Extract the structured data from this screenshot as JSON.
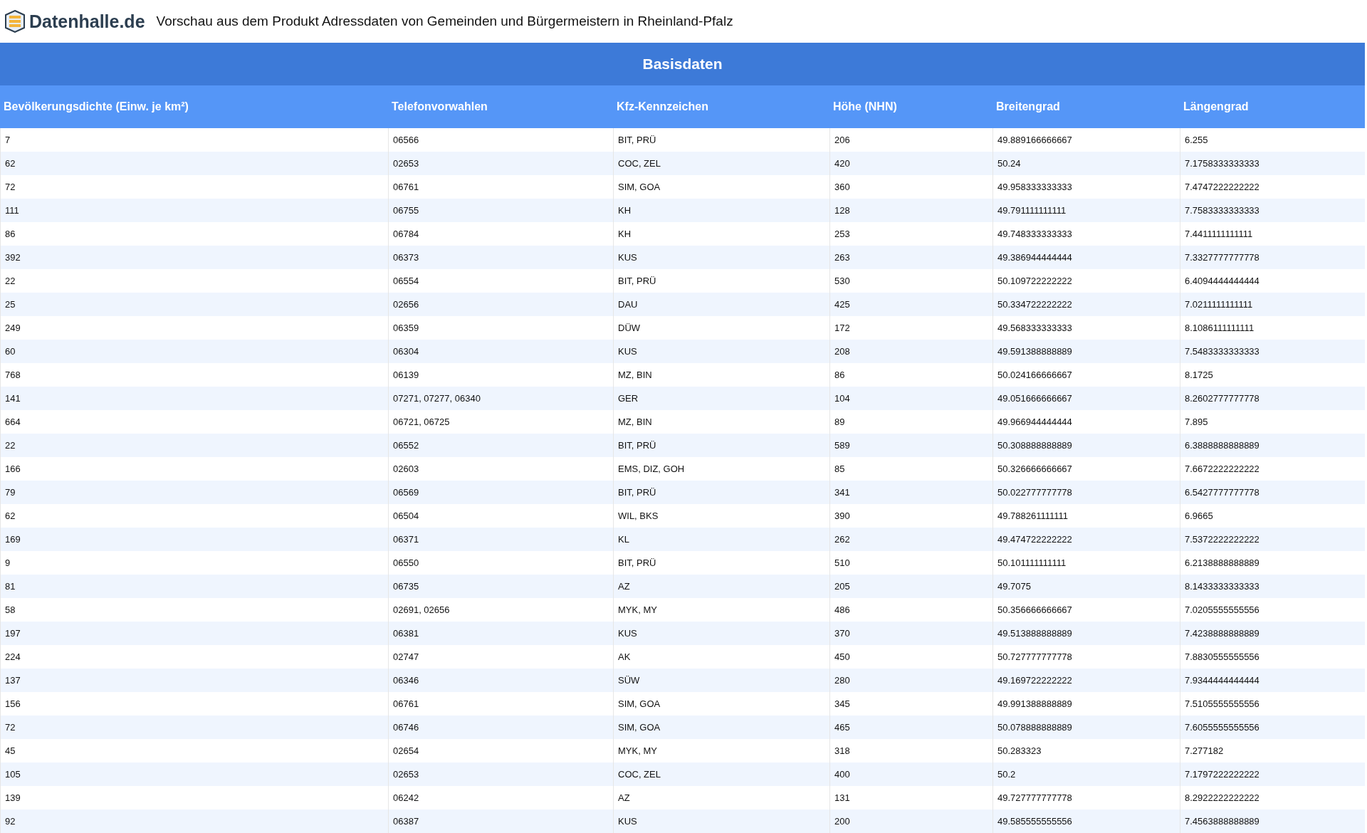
{
  "header": {
    "logo": "Datenhalle.de",
    "title": "Vorschau aus dem Produkt Adressdaten von Gemeinden und Bürgermeistern in Rheinland-Pfalz"
  },
  "table": {
    "group_title": "Basisdaten",
    "columns": [
      "Bevölkerungsdichte (Einw. je km²)",
      "Telefonvorwahlen",
      "Kfz-Kennzeichen",
      "Höhe (NHN)",
      "Breitengrad",
      "Längengrad"
    ],
    "rows": [
      [
        "7",
        "06566",
        "BIT, PRÜ",
        "206",
        "49.889166666667",
        "6.255"
      ],
      [
        "62",
        "02653",
        "COC, ZEL",
        "420",
        "50.24",
        "7.1758333333333"
      ],
      [
        "72",
        "06761",
        "SIM, GOA",
        "360",
        "49.958333333333",
        "7.4747222222222"
      ],
      [
        "111",
        "06755",
        "KH",
        "128",
        "49.791111111111",
        "7.7583333333333"
      ],
      [
        "86",
        "06784",
        "KH",
        "253",
        "49.748333333333",
        "7.4411111111111"
      ],
      [
        "392",
        "06373",
        "KUS",
        "263",
        "49.386944444444",
        "7.3327777777778"
      ],
      [
        "22",
        "06554",
        "BIT, PRÜ",
        "530",
        "50.109722222222",
        "6.4094444444444"
      ],
      [
        "25",
        "02656",
        "DAU",
        "425",
        "50.334722222222",
        "7.0211111111111"
      ],
      [
        "249",
        "06359",
        "DÜW",
        "172",
        "49.568333333333",
        "8.1086111111111"
      ],
      [
        "60",
        "06304",
        "KUS",
        "208",
        "49.591388888889",
        "7.5483333333333"
      ],
      [
        "768",
        "06139",
        "MZ, BIN",
        "86",
        "50.024166666667",
        "8.1725"
      ],
      [
        "141",
        "07271, 07277, 06340",
        "GER",
        "104",
        "49.051666666667",
        "8.2602777777778"
      ],
      [
        "664",
        "06721, 06725",
        "MZ, BIN",
        "89",
        "49.966944444444",
        "7.895"
      ],
      [
        "22",
        "06552",
        "BIT, PRÜ",
        "589",
        "50.308888888889",
        "6.3888888888889"
      ],
      [
        "166",
        "02603",
        "EMS, DIZ, GOH",
        "85",
        "50.326666666667",
        "7.6672222222222"
      ],
      [
        "79",
        "06569",
        "BIT, PRÜ",
        "341",
        "50.022777777778",
        "6.5427777777778"
      ],
      [
        "62",
        "06504",
        "WIL, BKS",
        "390",
        "49.788261111111",
        "6.9665"
      ],
      [
        "169",
        "06371",
        "KL",
        "262",
        "49.474722222222",
        "7.5372222222222"
      ],
      [
        "9",
        "06550",
        "BIT, PRÜ",
        "510",
        "50.101111111111",
        "6.2138888888889"
      ],
      [
        "81",
        "06735",
        "AZ",
        "205",
        "49.7075",
        "8.1433333333333"
      ],
      [
        "58",
        "02691, 02656",
        "MYK, MY",
        "486",
        "50.356666666667",
        "7.0205555555556"
      ],
      [
        "197",
        "06381",
        "KUS",
        "370",
        "49.513888888889",
        "7.4238888888889"
      ],
      [
        "224",
        "02747",
        "AK",
        "450",
        "50.727777777778",
        "7.8830555555556"
      ],
      [
        "137",
        "06346",
        "SÜW",
        "280",
        "49.169722222222",
        "7.9344444444444"
      ],
      [
        "156",
        "06761",
        "SIM, GOA",
        "345",
        "49.991388888889",
        "7.5105555555556"
      ],
      [
        "72",
        "06746",
        "SIM, GOA",
        "465",
        "50.078888888889",
        "7.6055555555556"
      ],
      [
        "45",
        "02654",
        "MYK, MY",
        "318",
        "50.283323",
        "7.277182"
      ],
      [
        "105",
        "02653",
        "COC, ZEL",
        "400",
        "50.2",
        "7.1797222222222"
      ],
      [
        "139",
        "06242",
        "AZ",
        "131",
        "49.727777777778",
        "8.2922222222222"
      ],
      [
        "92",
        "06387",
        "KUS",
        "200",
        "49.585555555556",
        "7.4563888888889"
      ]
    ]
  }
}
